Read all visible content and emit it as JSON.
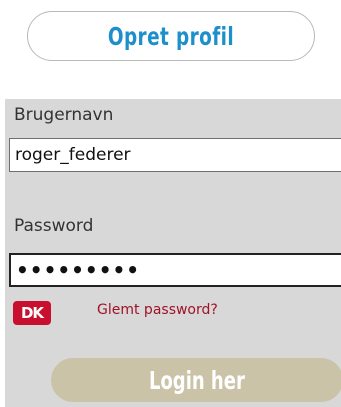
{
  "header": {
    "create_profile_label": "Opret profil"
  },
  "login": {
    "username_label": "Brugernavn",
    "username_value": "roger_federer",
    "password_label": "Password",
    "password_value": "•••••••••",
    "dk_logo_text": "DK",
    "forgot_password_label": "Glemt password?",
    "login_button_label": "Login her"
  },
  "colors": {
    "create_profile_text": "#1d8fca",
    "panel_background": "#d8d8d8",
    "forgot_link": "#a01228",
    "dk_logo_red": "#c8102e",
    "login_button": "#cbc3a8"
  }
}
